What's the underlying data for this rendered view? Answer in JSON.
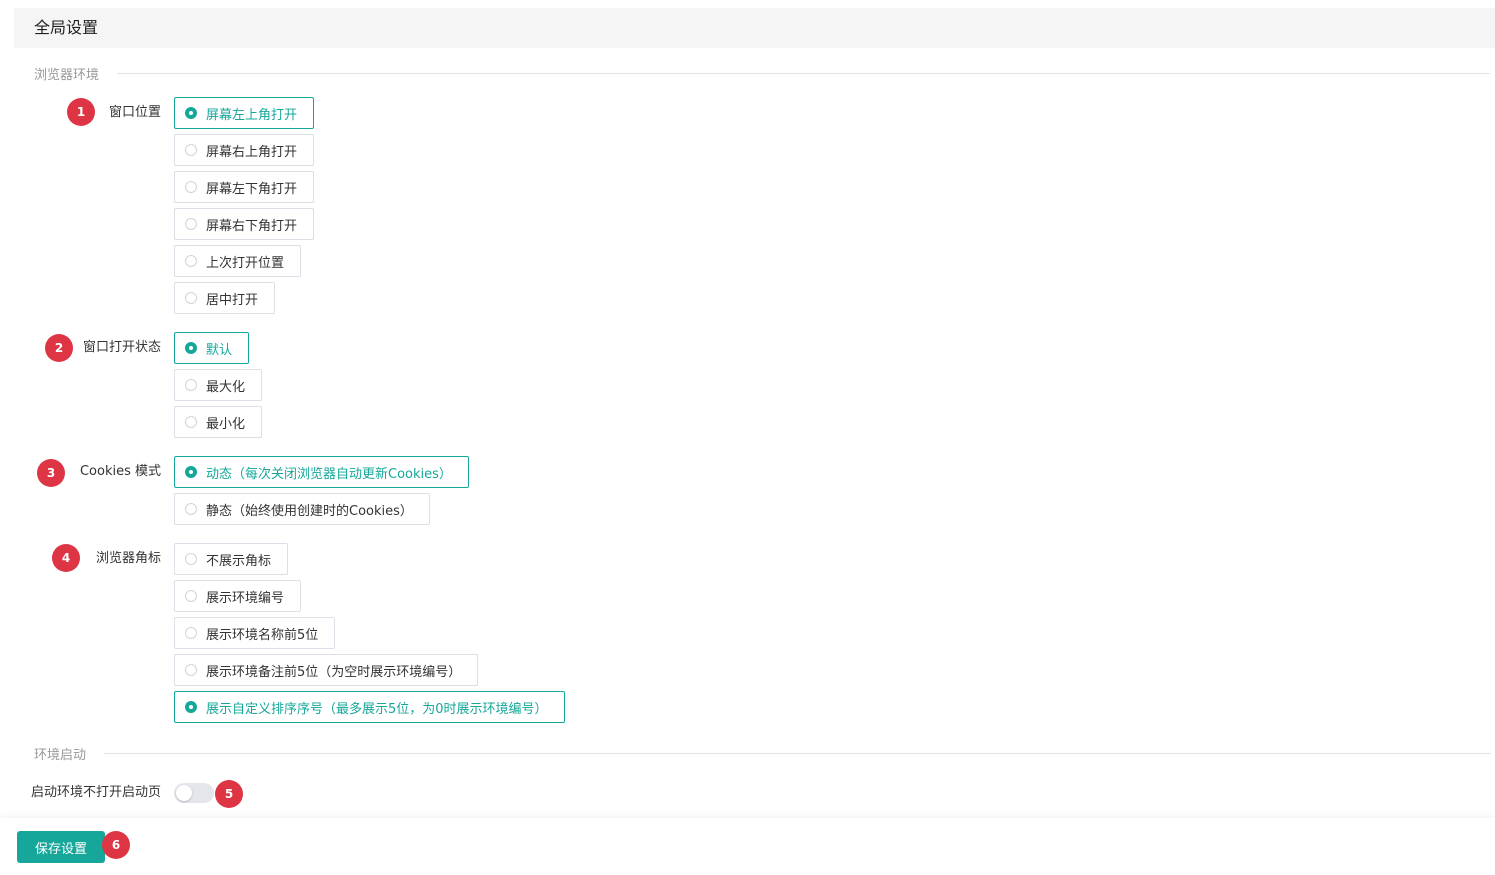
{
  "header": {
    "title": "全局设置"
  },
  "sections": {
    "browser_env": "浏览器环境",
    "env_launch": "环境启动"
  },
  "fields": {
    "window_position": {
      "badge": "1",
      "label": "窗口位置",
      "options": [
        "屏幕左上角打开",
        "屏幕右上角打开",
        "屏幕左下角打开",
        "屏幕右下角打开",
        "上次打开位置",
        "居中打开"
      ],
      "selected": "屏幕左上角打开"
    },
    "window_state": {
      "badge": "2",
      "label": "窗口打开状态",
      "options": [
        "默认",
        "最大化",
        "最小化"
      ],
      "selected": "默认"
    },
    "cookies_mode": {
      "badge": "3",
      "label": "Cookies 模式",
      "options": [
        "动态（每次关闭浏览器自动更新Cookies）",
        "静态（始终使用创建时的Cookies）"
      ],
      "selected": "动态（每次关闭浏览器自动更新Cookies）"
    },
    "browser_badge": {
      "badge": "4",
      "label": "浏览器角标",
      "options": [
        "不展示角标",
        "展示环境编号",
        "展示环境名称前5位",
        "展示环境备注前5位（为空时展示环境编号）",
        "展示自定义排序序号（最多展示5位，为0时展示环境编号）"
      ],
      "selected": "展示自定义排序序号（最多展示5位，为0时展示环境编号）"
    },
    "no_start_page": {
      "badge": "5",
      "label": "启动环境不打开启动页",
      "enabled": false
    }
  },
  "footer": {
    "save_label": "保存设置",
    "badge": "6"
  },
  "colors": {
    "accent": "#16a79a",
    "badge": "#de3545",
    "header_bg": "#f5f5f5"
  }
}
